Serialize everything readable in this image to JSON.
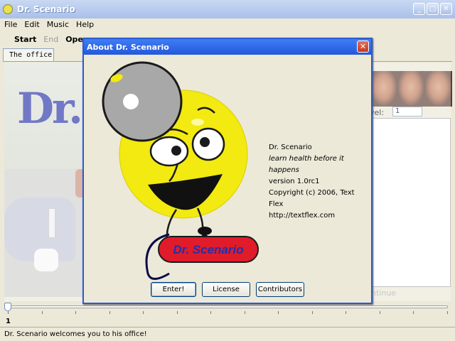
{
  "window": {
    "title": "Dr. Scenario"
  },
  "menu": [
    "File",
    "Edit",
    "Music",
    "Help"
  ],
  "toolbar": {
    "start": "Start",
    "end": "End",
    "open": "Open"
  },
  "tab": {
    "label": "The office"
  },
  "scene": {
    "logo_text": "Dr."
  },
  "right_panel": {
    "level_label": "vel:",
    "level_value": "1",
    "continue_label": "ntinue"
  },
  "slider": {
    "value": "1",
    "position": 0
  },
  "status": {
    "text": "Dr. Scenario welcomes you to his office!"
  },
  "dialog": {
    "title": "About Dr. Scenario",
    "logo_text": "Dr. Scenario",
    "app_name": "Dr. Scenario",
    "tagline": "learn health before it happens",
    "version": "version 1.0rc1",
    "copyright": "Copyright (c) 2006, Text Flex",
    "url": "http://textflex.com",
    "buttons": {
      "enter": "Enter!",
      "license": "License",
      "contributors": "Contributors"
    }
  },
  "colors": {
    "title_blue": "#2457dc",
    "smiley_yellow": "#f2ea10",
    "logo_red": "#e01b2a",
    "logo_blue": "#2530a8"
  }
}
